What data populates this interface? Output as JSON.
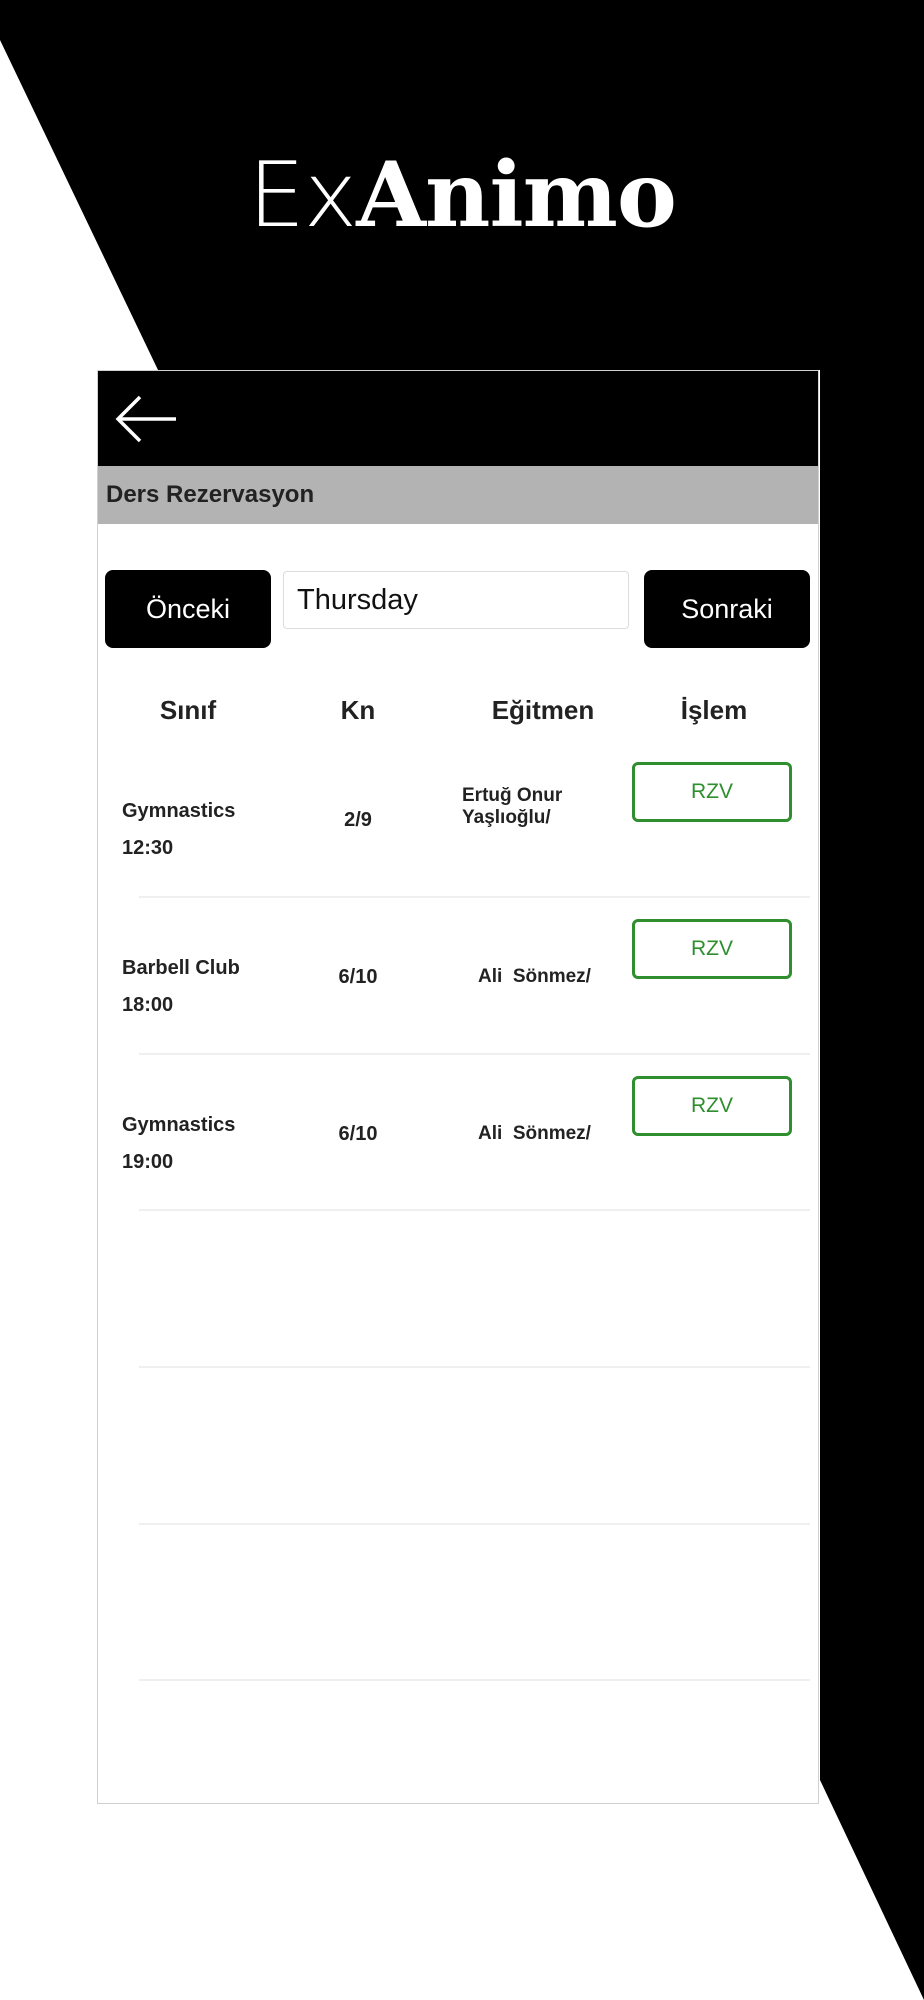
{
  "brand": {
    "prefix": "Ex",
    "name": "Animo"
  },
  "screen": {
    "title": "Ders Rezervasyon",
    "prev_label": "Önceki",
    "next_label": "Sonraki",
    "day_value": "Thursday",
    "columns": {
      "class": "Sınıf",
      "capacity": "Kn",
      "trainer": "Eğitmen",
      "action": "İşlem"
    },
    "rows": [
      {
        "class": "Gymnastics",
        "time": "12:30",
        "capacity": "2/9",
        "trainer_line1": "Ertuğ Onur",
        "trainer_line2": "Yaşlıoğlu/",
        "action": "RZV"
      },
      {
        "class": "Barbell Club",
        "time": "18:00",
        "capacity": "6/10",
        "trainer_line1": "Ali  Sönmez/",
        "trainer_line2": "",
        "action": "RZV"
      },
      {
        "class": "Gymnastics",
        "time": "19:00",
        "capacity": "6/10",
        "trainer_line1": "Ali  Sönmez/",
        "trainer_line2": "",
        "action": "RZV"
      }
    ]
  },
  "icons": {
    "back": "arrow-left-icon"
  },
  "colors": {
    "background": "#000000",
    "accent": "#2f8f2f",
    "header_bar": "#b3b3b3"
  }
}
